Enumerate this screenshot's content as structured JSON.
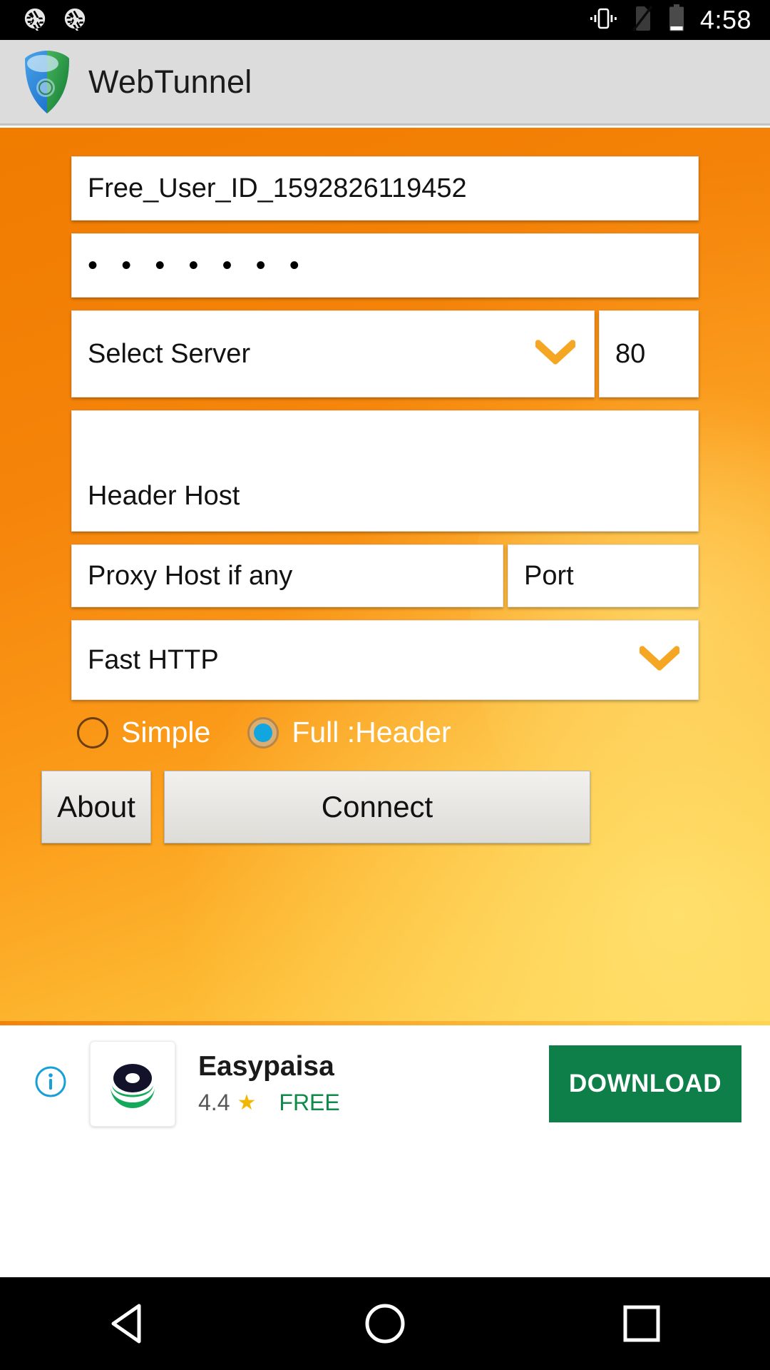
{
  "statusbar": {
    "icons": [
      "camera-aperture-icon",
      "camera-aperture-icon",
      "vibrate-icon",
      "no-sim-icon",
      "battery-icon"
    ],
    "clock": "4:58"
  },
  "appbar": {
    "logo": "webtunnel-shield-logo",
    "title": "WebTunnel"
  },
  "form": {
    "username": {
      "value": "Free_User_ID_1592826119452"
    },
    "password": {
      "value": "• • • • • • •"
    },
    "server": {
      "label": "Select Server",
      "chevron": "chevron-down-icon"
    },
    "server_port": {
      "value": "80"
    },
    "header_host": {
      "placeholder": "Header Host",
      "value": "Header Host"
    },
    "proxy_host": {
      "placeholder": "Proxy Host if any",
      "value": "Proxy Host if any"
    },
    "proxy_port": {
      "placeholder": "Port",
      "value": "Port"
    },
    "mode": {
      "label": "Fast HTTP",
      "chevron": "chevron-down-icon"
    },
    "radios": [
      {
        "label": "Simple",
        "selected": false
      },
      {
        "label": "Full :Header",
        "selected": true
      }
    ],
    "about_label": "About",
    "connect_label": "Connect"
  },
  "ad": {
    "info_icon": "info-icon",
    "app_icon": "easypaisa-logo-icon",
    "name": "Easypaisa",
    "rating": "4.4",
    "star": "★",
    "price": "FREE",
    "cta": "DOWNLOAD"
  },
  "navbar": {
    "back": "back-triangle-icon",
    "home": "home-circle-icon",
    "recents": "recents-square-icon"
  },
  "colors": {
    "accent_orange": "#f5840a",
    "accent_yellow": "#ffd451",
    "radio_blue": "#12a6e0",
    "download_green": "#0e7f49",
    "appbar_gray": "#dcdcdc"
  }
}
